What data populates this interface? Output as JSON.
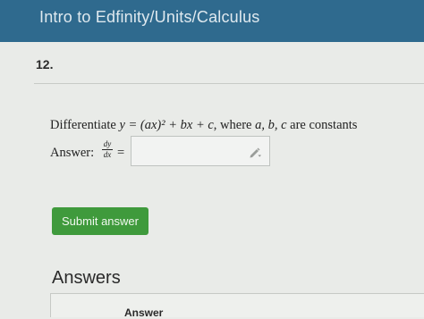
{
  "header": {
    "breadcrumb": "Intro to Edfinity/Units/Calculus"
  },
  "question": {
    "number": "12.",
    "prompt_prefix": "Differentiate",
    "expression": "y = (ax)² + bx + c",
    "prompt_suffix": ", where",
    "variables": "a, b, c",
    "prompt_end": "are constants",
    "answer_label": "Answer:",
    "fraction_top": "dy",
    "fraction_bottom": "dx",
    "equals": "=",
    "input_value": ""
  },
  "actions": {
    "submit_label": "Submit answer"
  },
  "answers": {
    "heading": "Answers",
    "column_header": "Answer"
  },
  "colors": {
    "header_bg": "#2f6a8e",
    "submit_bg": "#3f9a3c"
  },
  "icons": {
    "input_icon": "pencil-icon"
  }
}
